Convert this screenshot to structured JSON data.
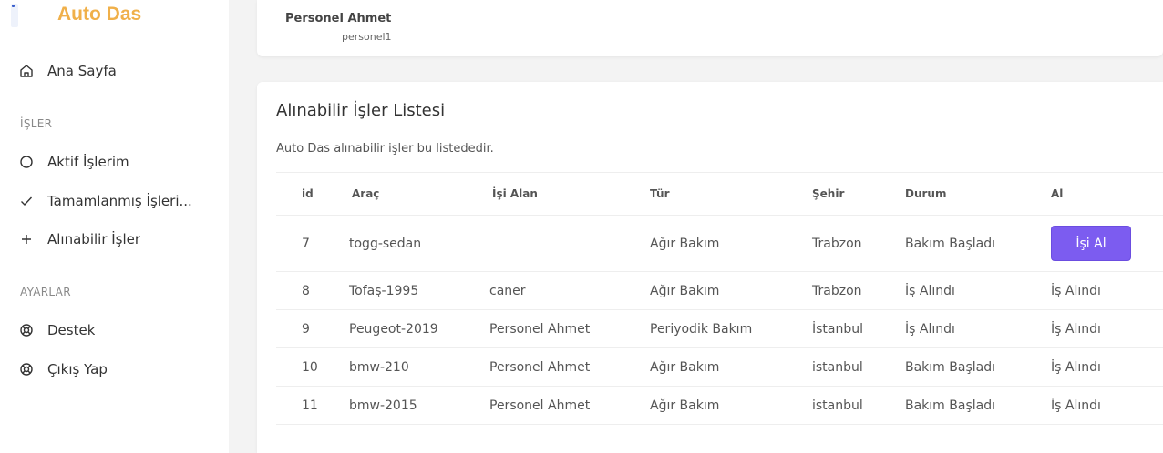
{
  "brand": {
    "title": "Auto Das"
  },
  "sidebar": {
    "home": {
      "label": "Ana Sayfa",
      "icon": "home-icon"
    },
    "section_jobs": "İŞLER",
    "jobs": [
      {
        "label": "Aktif İşlerim",
        "icon": "circle-icon"
      },
      {
        "label": "Tamamlanmış İşleri...",
        "icon": "check-icon"
      },
      {
        "label": "Alınabilir İşler",
        "icon": "plus-icon"
      }
    ],
    "section_settings": "AYARLAR",
    "settings": [
      {
        "label": "Destek",
        "icon": "lifebuoy-icon"
      },
      {
        "label": "Çıkış Yap",
        "icon": "lifebuoy-icon"
      }
    ]
  },
  "user": {
    "name": "Personel Ahmet",
    "login": "personel1"
  },
  "main": {
    "title": "Alınabilir İşler Listesi",
    "description": "Auto Das alınabilir işler bu listededir.",
    "columns": [
      "id",
      "Araç",
      "İşi Alan",
      "Tür",
      "Şehir",
      "Durum",
      "Al"
    ],
    "rows": [
      {
        "id": "7",
        "arac": "togg-sedan",
        "alan": "",
        "tur": "Ağır Bakım",
        "sehir": "Trabzon",
        "durum": "Bakım Başladı",
        "al": "İşi Al"
      },
      {
        "id": "8",
        "arac": "Tofaş-1995",
        "alan": "caner",
        "tur": "Ağır Bakım",
        "sehir": "Trabzon",
        "durum": "İş Alındı",
        "al": "İş Alındı"
      },
      {
        "id": "9",
        "arac": "Peugeot-2019",
        "alan": "Personel Ahmet",
        "tur": "Periyodik Bakım",
        "sehir": "İstanbul",
        "durum": "İş Alındı",
        "al": "İş Alındı"
      },
      {
        "id": "10",
        "arac": "bmw-210",
        "alan": "Personel Ahmet",
        "tur": "Ağır Bakım",
        "sehir": "istanbul",
        "durum": "Bakım Başladı",
        "al": "İş Alındı"
      },
      {
        "id": "11",
        "arac": "bmw-2015",
        "alan": "Personel Ahmet",
        "tur": "Ağır Bakım",
        "sehir": "istanbul",
        "durum": "Bakım Başladı",
        "al": "İş Alındı"
      }
    ]
  },
  "colors": {
    "brand": "#f0b04a",
    "button": "#7c5cf0"
  }
}
